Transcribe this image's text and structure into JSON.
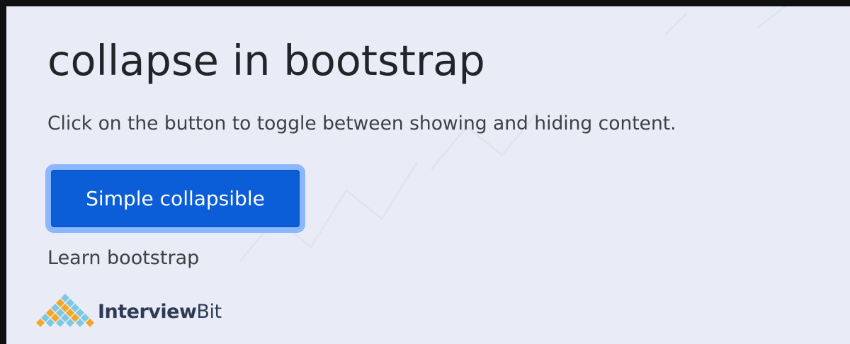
{
  "page": {
    "heading": "collapse in bootstrap",
    "description": "Click on the button to toggle between showing and hiding content."
  },
  "toggle_button": {
    "label": "Simple collapsible",
    "state": "focused",
    "expanded": true
  },
  "collapse_panel": {
    "text": "Learn bootstrap"
  },
  "logo": {
    "icon": "interviewbit-logo-icon",
    "name_bold": "Interview",
    "name_regular": "Bit"
  },
  "colors": {
    "background": "#e9ecf7",
    "button_primary": "#0b5ed7",
    "button_focus_ring": "#8bb7ff",
    "heading_text": "#212529",
    "body_text": "#3d4045"
  }
}
